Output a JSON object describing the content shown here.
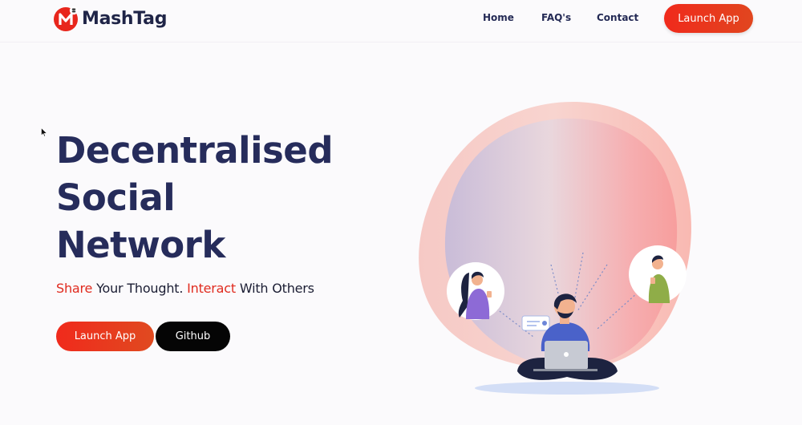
{
  "brand": {
    "name": "MashTag",
    "logo_icon": "mashtag-logo-icon"
  },
  "nav": {
    "home": "Home",
    "faq": "FAQ's",
    "contact": "Contact",
    "launch": "Launch App"
  },
  "hero": {
    "title_lines": [
      "Decentralised",
      "Social",
      "Network"
    ],
    "tagline": {
      "part1": "Share",
      "part2": " Your Thought. ",
      "part3": "Interact",
      "part4": " With Others"
    },
    "buttons": {
      "launch": "Launch App",
      "github": "Github"
    }
  },
  "colors": {
    "accent": "#e8321e",
    "heading": "#262c5b",
    "background": "#fbfafc",
    "github_button": "#050505"
  }
}
